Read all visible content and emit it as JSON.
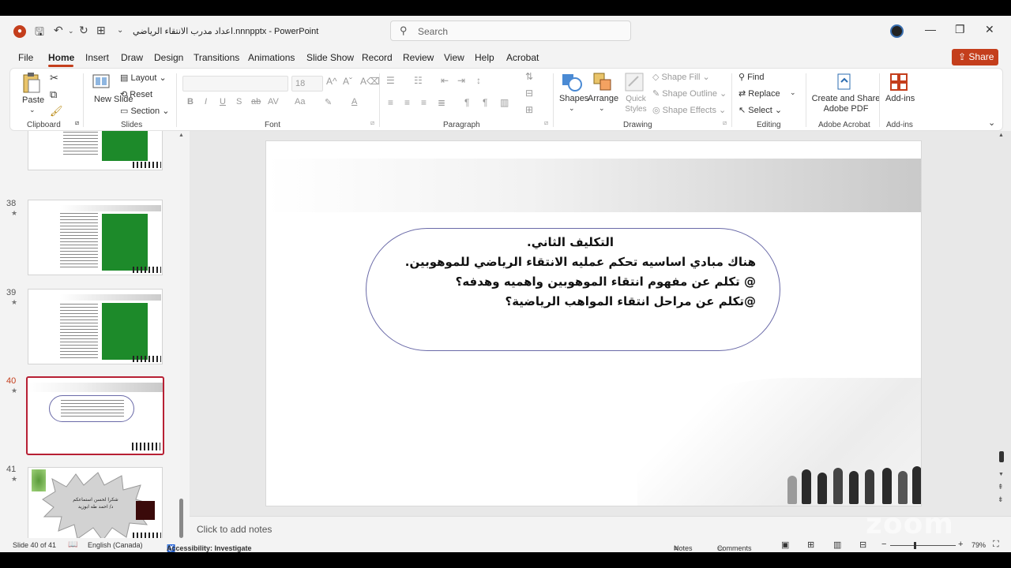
{
  "titlebar": {
    "document_title": "اعداد مدرب الانتقاء الرياضي.nnnpptx",
    "app_name": "PowerPoint",
    "separator": " - ",
    "search_placeholder": "Search"
  },
  "menu": {
    "items": [
      "File",
      "Home",
      "Insert",
      "Draw",
      "Design",
      "Transitions",
      "Animations",
      "Slide Show",
      "Record",
      "Review",
      "View",
      "Help",
      "Acrobat"
    ],
    "active": "Home",
    "share_label": "Share"
  },
  "ribbon": {
    "clipboard": {
      "paste": "Paste",
      "group": "Clipboard"
    },
    "slides": {
      "new_slide": "New Slide",
      "layout": "Layout",
      "reset": "Reset",
      "section": "Section",
      "group": "Slides"
    },
    "font": {
      "size": "18",
      "group": "Font"
    },
    "paragraph": {
      "group": "Paragraph"
    },
    "drawing": {
      "shapes": "Shapes",
      "arrange": "Arrange",
      "quick_styles": "Quick Styles",
      "shape_fill": "Shape Fill",
      "shape_outline": "Shape Outline",
      "shape_effects": "Shape Effects",
      "group": "Drawing"
    },
    "editing": {
      "find": "Find",
      "replace": "Replace",
      "select": "Select",
      "group": "Editing"
    },
    "adobe": {
      "create_share": "Create and Share Adobe PDF",
      "group": "Adobe Acrobat"
    },
    "addins": {
      "label": "Add-ins",
      "group": "Add-ins"
    }
  },
  "slides_panel": {
    "items": [
      {
        "number": "38"
      },
      {
        "number": "39"
      },
      {
        "number": "40",
        "selected": true
      },
      {
        "number": "41",
        "text_line1": "شكرا لحسن استماعكم",
        "text_line2": "د/ احمد طه ابوزيد"
      }
    ]
  },
  "slide": {
    "title": "التكليف الثاني.",
    "line1": "هناك مبادي اساسيه تحكم عمليه الانتقاء الرياضي للموهوبين.",
    "line2": "@ تكلم عن مفهوم انتقاء الموهوبين واهميه وهدفه؟",
    "line3": "@تكلم عن مراحل انتقاء المواهب الرياضية؟"
  },
  "notes": {
    "placeholder": "Click to add notes"
  },
  "status": {
    "slide_position": "Slide 40 of 41",
    "language": "English (Canada)",
    "accessibility": "Accessibility: Investigate",
    "notes_label": "Notes",
    "comments_label": "Comments",
    "zoom": "79%"
  },
  "overlay": {
    "watermark": "zoom"
  },
  "colors": {
    "accent": "#c43e1c",
    "selected_border": "#b72034",
    "pitch_green": "#1d8a2a"
  }
}
